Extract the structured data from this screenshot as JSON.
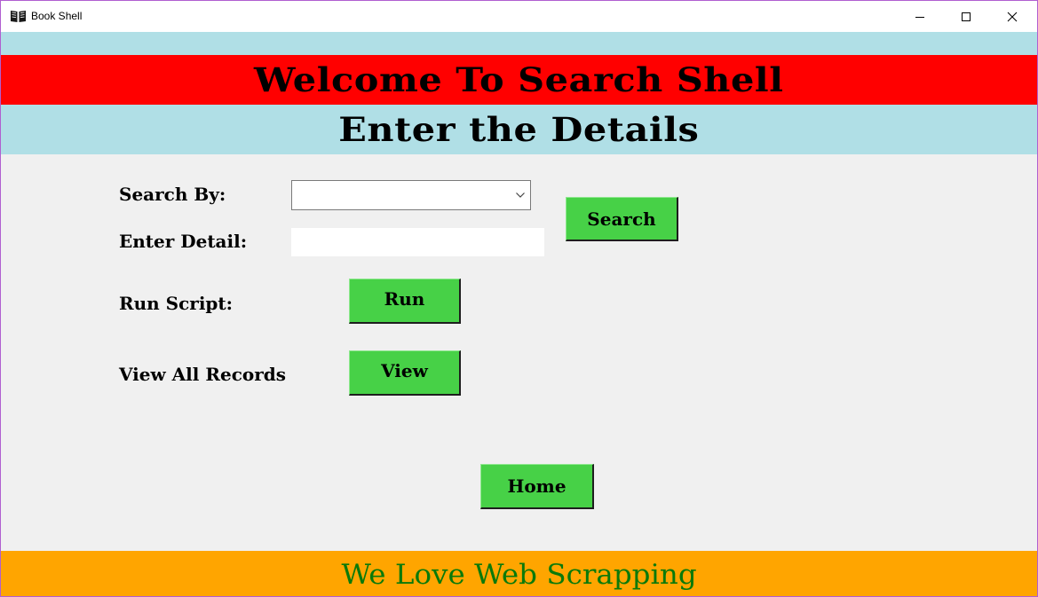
{
  "window": {
    "title": "Book Shell",
    "icon": "open-book-icon",
    "controls": [
      "minimize-icon",
      "maximize-icon",
      "close-icon"
    ]
  },
  "header": {
    "welcome": "Welcome To Search Shell",
    "subtitle": "Enter the Details"
  },
  "form": {
    "search_by_label": "Search By:",
    "search_by_value": "",
    "enter_detail_label": "Enter Detail:",
    "enter_detail_value": "",
    "search_button": "Search",
    "run_script_label": "Run Script:",
    "run_button": "Run",
    "view_all_label": "View All Records",
    "view_button": "View",
    "home_button": "Home"
  },
  "footer": {
    "text": "We Love Web Scrapping"
  },
  "colors": {
    "light_blue_band": "#b0dfe6",
    "red_band": "#ff0000",
    "button_green": "#47d147",
    "footer_orange": "#ffa500",
    "footer_text_green": "#0a7a0a",
    "body_background": "#f0f0f0"
  }
}
